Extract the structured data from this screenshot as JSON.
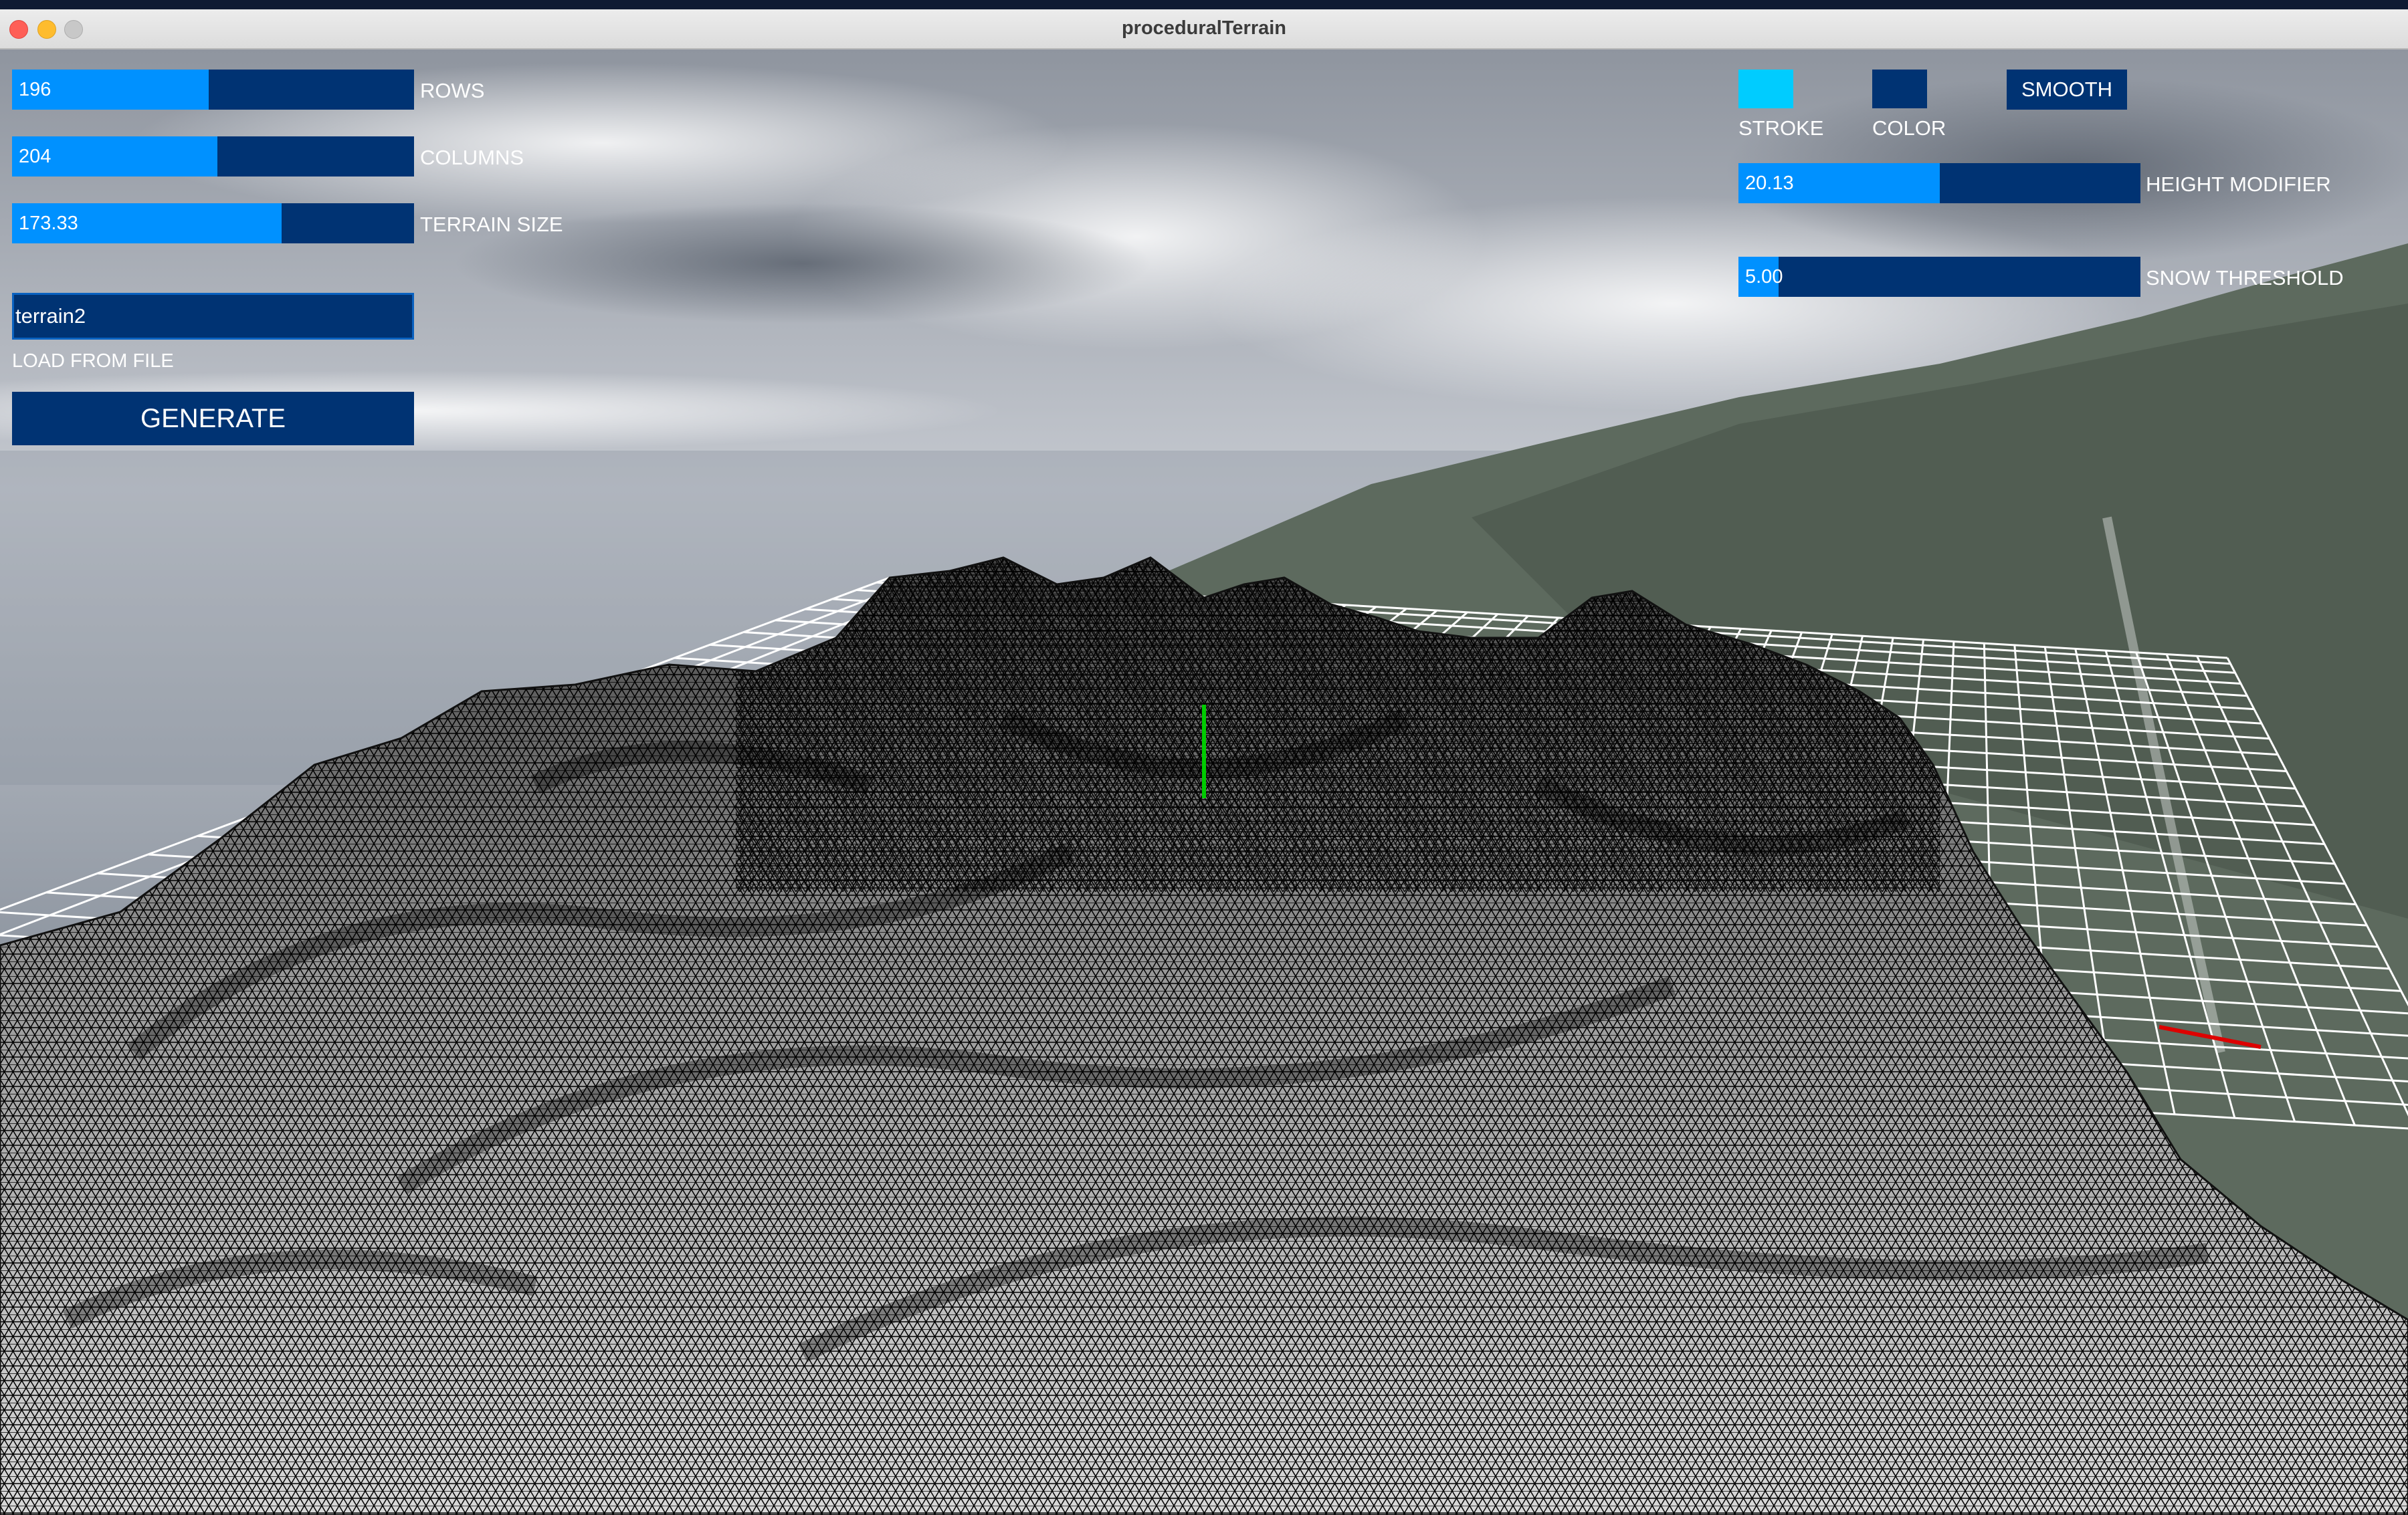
{
  "window": {
    "title": "proceduralTerrain"
  },
  "left_panel": {
    "rows": {
      "value": "196",
      "label": "ROWS",
      "fraction": 0.49
    },
    "columns": {
      "value": "204",
      "label": "COLUMNS",
      "fraction": 0.51
    },
    "terrain_size": {
      "value": "173.33",
      "label": "TERRAIN SIZE",
      "fraction": 0.67
    },
    "file_field": {
      "value": "terrain2",
      "label": "LOAD FROM FILE"
    },
    "generate_label": "GENERATE"
  },
  "right_panel": {
    "stroke": {
      "label": "STROKE",
      "color": "#00ccff"
    },
    "color": {
      "label": "COLOR",
      "color": "#003373"
    },
    "smooth_label": "SMOOTH",
    "height_modifier": {
      "value": "20.13",
      "label": "HEIGHT MODIFIER",
      "fraction": 0.5
    },
    "snow_threshold": {
      "value": "5.00",
      "label": "SNOW THRESHOLD",
      "fraction": 0.1
    }
  },
  "colors": {
    "slider_bg": "#003373",
    "slider_fill": "#0091ff",
    "grid": "#ffffff",
    "mesh_line": "#000000",
    "axis_y": "#00cc00",
    "axis_x": "#dd0000"
  }
}
